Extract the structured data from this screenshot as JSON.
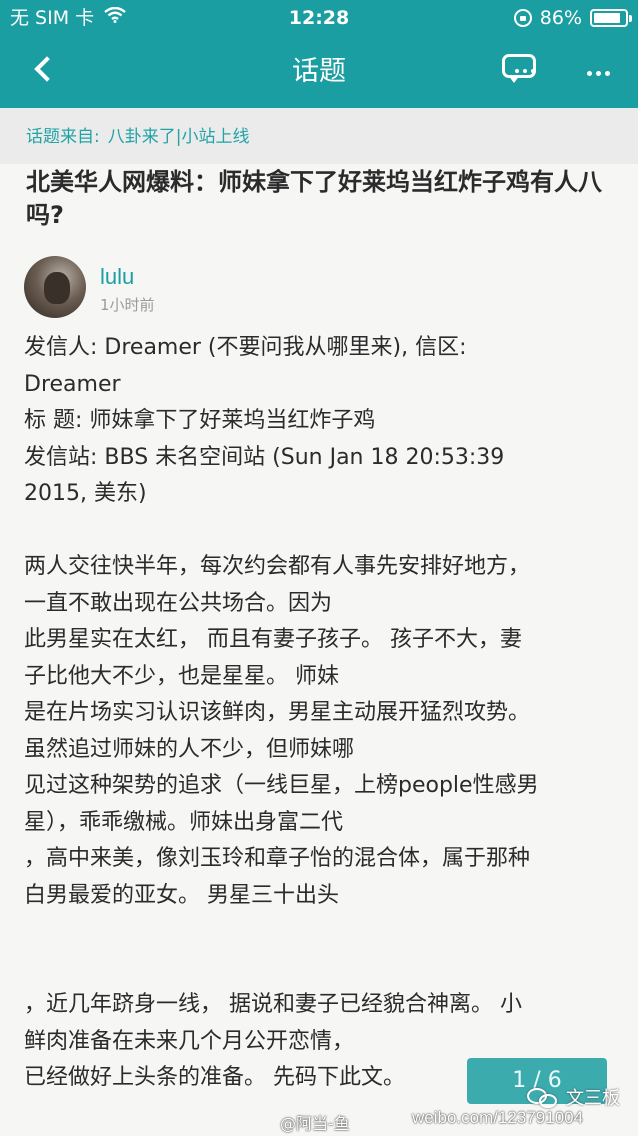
{
  "status_bar": {
    "carrier": "无 SIM 卡",
    "time": "12:28",
    "battery": "86%",
    "battery_level": 0.86
  },
  "nav": {
    "title": "话题",
    "icons": [
      "back-chevron-icon",
      "comment-icon",
      "more-icon"
    ]
  },
  "source": {
    "label": "话题来自:",
    "value": "八卦来了|小站上线"
  },
  "topic": {
    "title": "北美华人网爆料：师妹拿下了好莱坞当红炸子鸡有人八吗?"
  },
  "author": {
    "name": "lulu",
    "time": "1小时前"
  },
  "post": {
    "lines": [
      "发信人: Dreamer (不要问我从哪里来), 信区:",
      "Dreamer",
      "标  题: 师妹拿下了好莱坞当红炸子鸡",
      "发信站: BBS 未名空间站 (Sun Jan 18 20:53:39",
      "2015, 美东)",
      "",
      "两人交往快半年，每次约会都有人事先安排好地方，",
      "一直不敢出现在公共场合。因为",
      "此男星实在太红， 而且有妻子孩子。 孩子不大，妻",
      "子比他大不少，也是星星。 师妹",
      "是在片场实习认识该鲜肉，男星主动展开猛烈攻势。",
      "虽然追过师妹的人不少，但师妹哪",
      "见过这种架势的追求（一线巨星，上榜people性感男",
      "星），乖乖缴械。师妹出身富二代",
      "，高中来美，像刘玉玲和章子怡的混合体，属于那种",
      "白男最爱的亚女。 男星三十出头",
      "",
      "",
      "，近几年跻身一线， 据说和妻子已经貌合神离。 小",
      "鲜肉准备在未来几个月公开恋情，",
      "已经做好上头条的准备。 先码下此文。"
    ]
  },
  "pager": {
    "label": "1 / 6"
  },
  "watermark": {
    "user": "@阿当-鱼",
    "site": "weibo.com/123791004",
    "brand": "文三板"
  }
}
